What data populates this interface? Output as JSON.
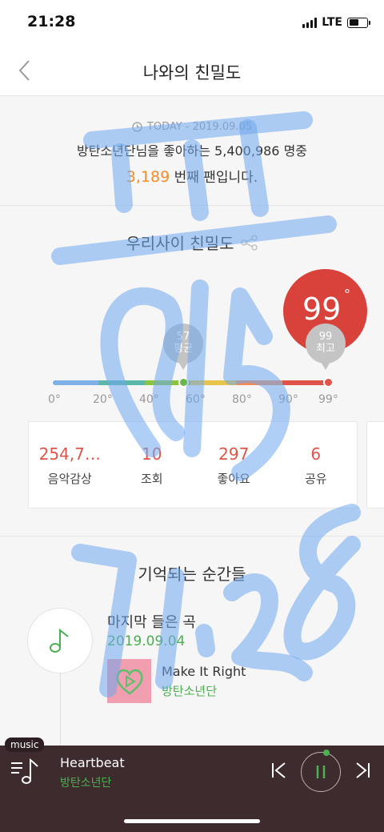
{
  "status": {
    "time": "21:28",
    "network": "LTE"
  },
  "nav": {
    "title": "나와의 친밀도"
  },
  "rank": {
    "today": "TODAY - 2019.09.05",
    "line1": "방탄소년단님을 좋아하는 5,400,986 명중",
    "rank_number": "3,189",
    "line2_suffix": " 번째 팬입니다."
  },
  "intimacy": {
    "title": "우리사이 친밀도",
    "score": "99",
    "score_unit": "°",
    "avg_value": "57",
    "avg_label": "평균",
    "max_value": "99",
    "max_label": "최고",
    "avg_level": 57,
    "max_level": 99,
    "scale_labels": [
      "0°",
      "20°",
      "40°",
      "60°",
      "80°",
      "90°",
      "99°"
    ],
    "scale_colors": [
      "#7fb0e8",
      "#5cb8a8",
      "#8cc63f",
      "#e8c44a",
      "#ee8c5a",
      "#e0534a"
    ],
    "score_color": "#d9413b"
  },
  "stats": [
    {
      "value": "254,7…",
      "label": "음악감상"
    },
    {
      "value": "10",
      "label": "조회"
    },
    {
      "value": "297",
      "label": "좋아요"
    },
    {
      "value": "6",
      "label": "공유"
    }
  ],
  "moments": {
    "title": "기억되는 순간들",
    "last_song_label": "마지막 들은 곡",
    "last_song_date": "2019.09.04",
    "song_title": "Make It Right",
    "song_artist": "방탄소년단"
  },
  "player": {
    "tag": "music",
    "title": "Heartbeat",
    "artist": "방탄소년단"
  },
  "overlay_icon": "handwritten-scrawl",
  "accent_green": "#4caf50",
  "accent_orange": "#f08d2c"
}
